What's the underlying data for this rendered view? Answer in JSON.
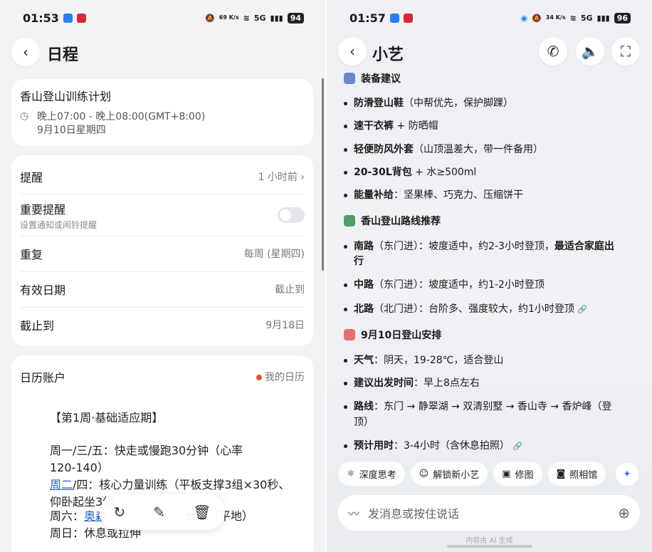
{
  "left": {
    "status": {
      "time": "01:53",
      "net_speed": "69 K/s",
      "signal": "5G",
      "battery": "94"
    },
    "nav": {
      "back_icon": "chevron-left-icon",
      "title": "日程"
    },
    "event": {
      "title": "香山登山训练计划",
      "time": "晚上07:00 - 晚上08:00(GMT+8:00)",
      "date": "9月10日星期四"
    },
    "settings": {
      "reminder": {
        "label": "提醒",
        "value": "1 小时前"
      },
      "important": {
        "label": "重要提醒",
        "sub": "设置通知或闹铃提醒"
      },
      "repeat": {
        "label": "重复",
        "value": "每周 (星期四)"
      },
      "valid": {
        "label": "有效日期",
        "value": "截止到"
      },
      "until": {
        "label": "截止到",
        "value": "9月18日"
      }
    },
    "calendar": {
      "label": "日历账户",
      "value": "我的日历",
      "dot_color": "#d8553a"
    },
    "plan": {
      "heading": "【第1周·基础适应期】",
      "l1": "周一/三/五：快走或慢跑30分钟（心率",
      "l2": "120-140）",
      "l3_link": "周二",
      "l3": "/四：核心力量训练（平板支撑3组×30秒、",
      "l4": "仰卧起坐3组",
      "l5a": "周六：",
      "l5_link": "奥森",
      "l5b": "公里（平地）",
      "l6": "周日：休息或拉伸"
    },
    "floatbar": {
      "share_icon": "share-icon",
      "edit_icon": "edit-icon",
      "delete_icon": "trash-icon"
    }
  },
  "right": {
    "status": {
      "time": "01:57",
      "net_speed": "34 K/s",
      "signal": "5G",
      "battery": "96"
    },
    "nav": {
      "back_icon": "chevron-left-icon",
      "title": "小艺"
    },
    "equipment": {
      "heading": "装备建议",
      "items": [
        {
          "bold": "防滑登山鞋",
          "rest": "（中帮优先，保护脚踝）"
        },
        {
          "bold": "速干衣裤",
          "rest": " + 防晒帽"
        },
        {
          "bold": "轻便防风外套",
          "rest": "（山顶温差大，带一件备用）"
        },
        {
          "bold": "20-30L背包",
          "rest": " + 水≥500ml"
        },
        {
          "bold": "能量补给",
          "rest": "：坚果棒、巧克力、压缩饼干"
        }
      ]
    },
    "routes": {
      "heading": "香山登山路线推荐",
      "south": {
        "bold": "南路",
        "rest": "（东门进）：坡度适中，约2-3小时登顶，",
        "bold2": "最适合家庭出",
        "wrap": "行"
      },
      "middle": {
        "bold": "中路",
        "rest": "（东门进）：坡度适中，约1-2小时登顶"
      },
      "north": {
        "bold": "北路",
        "rest": "（北门进）：台阶多、强度较大，约1小时登顶"
      }
    },
    "schedule": {
      "heading": "9月10日登山安排",
      "weather": {
        "bold": "天气",
        "rest": "：阴天，19-28℃，适合登山"
      },
      "depart": {
        "bold": "建议出发时间",
        "rest": "：早上8点左右"
      },
      "route": {
        "bold": "路线",
        "rest": "：东门 → 静翠湖 → 双清别墅 → 香山寺 → 香炉峰（登",
        "wrap": "顶）"
      },
      "duration": {
        "bold": "预计用时",
        "rest": "：3-4小时（含休息拍照）"
      }
    },
    "chips": [
      "深度思考",
      "解锁新小艺",
      "修图",
      "照相馆"
    ],
    "input": {
      "placeholder": "发消息或按住说话"
    },
    "footer": "内容由 AI 生成"
  }
}
